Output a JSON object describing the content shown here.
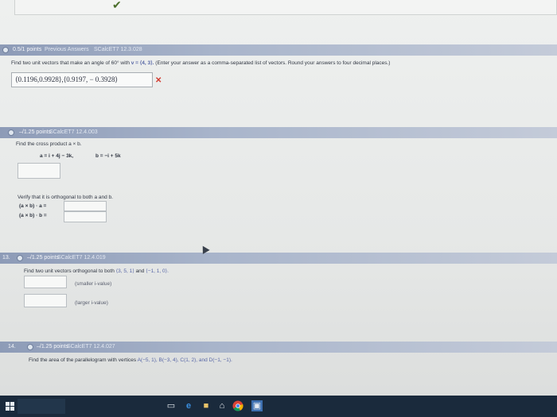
{
  "question_prev": {
    "status": "correct"
  },
  "q11": {
    "points": "0.5/1 points",
    "previous_answers": "Previous Answers",
    "source": "SCalcET7 12.3.028",
    "prompt_a": "Find two unit vectors that make an angle of 60° with ",
    "prompt_v": "v = ⟨4, 3⟩.",
    "prompt_b": " (Enter your answer as a comma-separated list of vectors. Round your answers to four decimal places.)",
    "answer": "⟨0.1196,0.9928⟩,⟨0.9197, − 0.3928⟩",
    "result": "✕"
  },
  "q12": {
    "points": "–/1.25 points",
    "source": "SCalcET7 12.4.003",
    "prompt": "Find the cross product a × b.",
    "a_def": "a = i + 4j − 3k,",
    "b_def": "b = −i + 5k",
    "verify": "Verify that it is orthogonal to both a and b.",
    "line1": "(a × b) · a =",
    "line2": "(a × b) · b ="
  },
  "q13": {
    "number": "13.",
    "points": "–/1.25 points",
    "source": "SCalcET7 12.4.019",
    "prompt_a": "Find two unit vectors orthogonal to both ",
    "vec1": "⟨3, 5, 1⟩",
    "and": " and ",
    "vec2": "⟨−1, 1, 0⟩.",
    "hint1": "(smaller i-value)",
    "hint2": "(larger i-value)"
  },
  "q14": {
    "number": "14.",
    "points": "–/1.25 points",
    "source": "SCalcET7 12.4.027",
    "prompt_a": "Find the area of the parallelogram with vertices ",
    "vertices": "A(−5, 1), B(−3, 4), C(1, 2), and D(−1, −1)."
  },
  "taskbar": {
    "icons": [
      "windows-start-icon",
      "search-box",
      "file-explorer-icon",
      "edge-browser-icon",
      "folder-icon",
      "store-icon",
      "chrome-icon",
      "photos-icon"
    ]
  },
  "colors": {
    "header_bar": "#8d9bb7",
    "incorrect": "#d23a2e",
    "correct": "#4a6e2a",
    "taskbar": "#1a2a3c"
  }
}
